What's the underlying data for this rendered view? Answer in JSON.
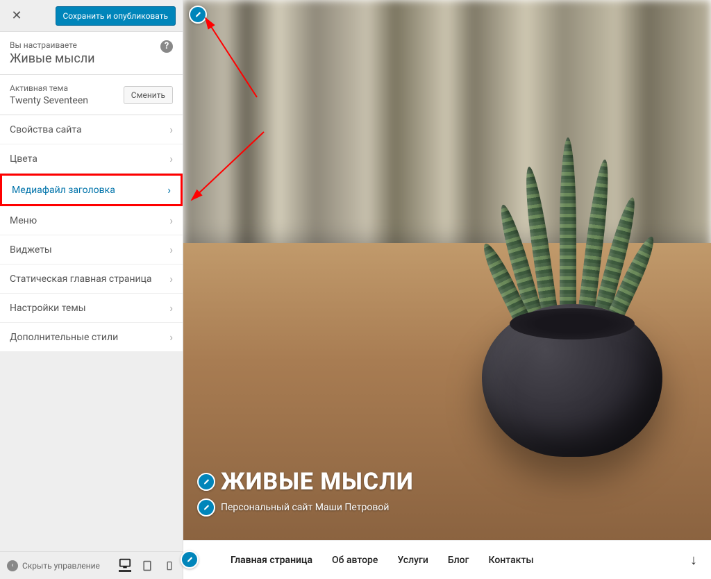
{
  "header": {
    "publish_label": "Сохранить и опубликовать"
  },
  "customizing": {
    "label": "Вы настраиваете",
    "site_title": "Живые мысли"
  },
  "theme": {
    "label": "Активная тема",
    "name": "Twenty Seventeen",
    "change_label": "Сменить"
  },
  "nav": [
    {
      "label": "Свойства сайта",
      "selected": false
    },
    {
      "label": "Цвета",
      "selected": false
    },
    {
      "label": "Медиафайл заголовка",
      "selected": true
    },
    {
      "label": "Меню",
      "selected": false
    },
    {
      "label": "Виджеты",
      "selected": false
    },
    {
      "label": "Статическая главная страница",
      "selected": false
    },
    {
      "label": "Настройки темы",
      "selected": false
    },
    {
      "label": "Дополнительные стили",
      "selected": false
    }
  ],
  "footer": {
    "collapse_label": "Скрыть управление"
  },
  "preview": {
    "site_title": "ЖИВЫЕ МЫСЛИ",
    "tagline": "Персональный сайт Маши Петровой",
    "menu": [
      "Главная страница",
      "Об авторе",
      "Услуги",
      "Блог",
      "Контакты"
    ]
  }
}
